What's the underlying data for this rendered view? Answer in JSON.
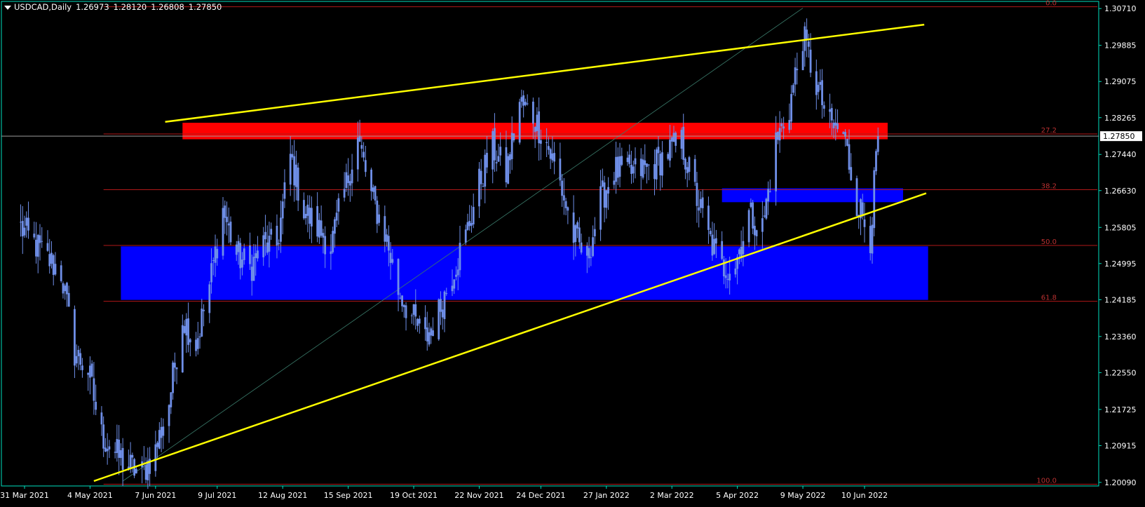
{
  "header": {
    "symbol": "USDCAD,Daily",
    "open": "1.26973",
    "high": "1.28120",
    "low": "1.26808",
    "close": "1.27850"
  },
  "colors": {
    "background": "#000000",
    "axis": "#00e0c0",
    "candle": "#6f8fe8",
    "fib_line": "#b01818",
    "fib_label": "#b83030",
    "trendline": "#ffff00",
    "resistance_zone": "#ff0000",
    "support_zone": "#0000ff",
    "price_line": "#9a9a9a",
    "current_price_bg": "#ffffff",
    "current_price_text": "#000000",
    "diagonal": "#3a7a6a"
  },
  "chart_data": {
    "type": "candlestick",
    "symbol": "USDCAD",
    "timeframe": "Daily",
    "y_ticks": [
      "1.30710",
      "1.29885",
      "1.29075",
      "1.28265",
      "1.27440",
      "1.26630",
      "1.25805",
      "1.24995",
      "1.24185",
      "1.23360",
      "1.22550",
      "1.21725",
      "1.20915",
      "1.20090"
    ],
    "ylim": [
      1.2001,
      1.3087
    ],
    "x_ticks": [
      {
        "label": "31 Mar 2021",
        "date": "2021-03-31"
      },
      {
        "label": "4 May 2021",
        "date": "2021-05-04"
      },
      {
        "label": "7 Jun 2021",
        "date": "2021-06-07"
      },
      {
        "label": "9 Jul 2021",
        "date": "2021-07-09"
      },
      {
        "label": "12 Aug 2021",
        "date": "2021-08-12"
      },
      {
        "label": "15 Sep 2021",
        "date": "2021-09-15"
      },
      {
        "label": "19 Oct 2021",
        "date": "2021-10-19"
      },
      {
        "label": "22 Nov 2021",
        "date": "2021-11-22"
      },
      {
        "label": "24 Dec 2021",
        "date": "2021-12-24"
      },
      {
        "label": "27 Jan 2022",
        "date": "2022-01-27"
      },
      {
        "label": "2 Mar 2022",
        "date": "2022-03-02"
      },
      {
        "label": "5 Apr 2022",
        "date": "2022-04-05"
      },
      {
        "label": "9 May 2022",
        "date": "2022-05-09"
      },
      {
        "label": "10 Jun 2022",
        "date": "2022-06-10"
      }
    ],
    "current_price": "1.27850",
    "fibonacci_levels": [
      {
        "label": "0.0",
        "price": 1.3075
      },
      {
        "label": "27.2",
        "price": 1.279
      },
      {
        "label": "38.2",
        "price": 1.2665
      },
      {
        "label": "50.0",
        "price": 1.254
      },
      {
        "label": "61.8",
        "price": 1.2415
      },
      {
        "label": "100.0",
        "price": 1.2005
      }
    ],
    "zones": [
      {
        "name": "resistance",
        "from_date": "2021-06-21",
        "to_date": "2022-06-22",
        "price_low": 1.2778,
        "price_high": 1.2815
      },
      {
        "name": "support",
        "from_date": "2021-05-20",
        "to_date": "2022-07-13",
        "price_low": 1.2418,
        "price_high": 1.2538
      },
      {
        "name": "intermediate-support",
        "from_date": "2022-03-28",
        "to_date": "2022-06-30",
        "price_low": 1.2637,
        "price_high": 1.2668
      }
    ],
    "trendlines": [
      {
        "name": "upper-channel",
        "start": {
          "date": "2021-06-12",
          "price": 1.2817
        },
        "end": {
          "date": "2022-07-11",
          "price": 1.3035
        }
      },
      {
        "name": "lower-trendline",
        "start": {
          "date": "2021-05-06",
          "price": 1.2012
        },
        "end": {
          "date": "2022-07-12",
          "price": 1.2657
        }
      }
    ],
    "diagonal": {
      "start": {
        "date": "2021-05-21",
        "price": 1.2012
      },
      "end": {
        "date": "2022-05-09",
        "price": 1.3072
      }
    },
    "closes": [
      {
        "date": "2021-03-29",
        "close": 1.258
      },
      {
        "date": "2021-04-05",
        "close": 1.2545
      },
      {
        "date": "2021-04-12",
        "close": 1.251
      },
      {
        "date": "2021-04-19",
        "close": 1.248
      },
      {
        "date": "2021-04-26",
        "close": 1.23
      },
      {
        "date": "2021-05-03",
        "close": 1.226
      },
      {
        "date": "2021-05-10",
        "close": 1.2115
      },
      {
        "date": "2021-05-17",
        "close": 1.2075
      },
      {
        "date": "2021-05-24",
        "close": 1.2045
      },
      {
        "date": "2021-05-31",
        "close": 1.203
      },
      {
        "date": "2021-06-07",
        "close": 1.208
      },
      {
        "date": "2021-06-14",
        "close": 1.219
      },
      {
        "date": "2021-06-21",
        "close": 1.238
      },
      {
        "date": "2021-06-28",
        "close": 1.232
      },
      {
        "date": "2021-07-05",
        "close": 1.245
      },
      {
        "date": "2021-07-12",
        "close": 1.262
      },
      {
        "date": "2021-07-19",
        "close": 1.252
      },
      {
        "date": "2021-07-26",
        "close": 1.249
      },
      {
        "date": "2021-08-02",
        "close": 1.254
      },
      {
        "date": "2021-08-09",
        "close": 1.254
      },
      {
        "date": "2021-08-16",
        "close": 1.274
      },
      {
        "date": "2021-08-23",
        "close": 1.262
      },
      {
        "date": "2021-08-30",
        "close": 1.258
      },
      {
        "date": "2021-09-06",
        "close": 1.254
      },
      {
        "date": "2021-09-13",
        "close": 1.266
      },
      {
        "date": "2021-09-20",
        "close": 1.278
      },
      {
        "date": "2021-09-27",
        "close": 1.265
      },
      {
        "date": "2021-10-04",
        "close": 1.257
      },
      {
        "date": "2021-10-11",
        "close": 1.244
      },
      {
        "date": "2021-10-18",
        "close": 1.238
      },
      {
        "date": "2021-10-25",
        "close": 1.233
      },
      {
        "date": "2021-11-01",
        "close": 1.239
      },
      {
        "date": "2021-11-08",
        "close": 1.248
      },
      {
        "date": "2021-11-15",
        "close": 1.256
      },
      {
        "date": "2021-11-22",
        "close": 1.268
      },
      {
        "date": "2021-11-29",
        "close": 1.276
      },
      {
        "date": "2021-12-06",
        "close": 1.27
      },
      {
        "date": "2021-12-13",
        "close": 1.286
      },
      {
        "date": "2021-12-20",
        "close": 1.283
      },
      {
        "date": "2021-12-27",
        "close": 1.277
      },
      {
        "date": "2022-01-03",
        "close": 1.268
      },
      {
        "date": "2022-01-10",
        "close": 1.256
      },
      {
        "date": "2022-01-17",
        "close": 1.251
      },
      {
        "date": "2022-01-24",
        "close": 1.264
      },
      {
        "date": "2022-01-31",
        "close": 1.271
      },
      {
        "date": "2022-02-07",
        "close": 1.27
      },
      {
        "date": "2022-02-14",
        "close": 1.271
      },
      {
        "date": "2022-02-21",
        "close": 1.272
      },
      {
        "date": "2022-02-28",
        "close": 1.275
      },
      {
        "date": "2022-03-07",
        "close": 1.277
      },
      {
        "date": "2022-03-14",
        "close": 1.266
      },
      {
        "date": "2022-03-21",
        "close": 1.256
      },
      {
        "date": "2022-03-28",
        "close": 1.249
      },
      {
        "date": "2022-04-04",
        "close": 1.25
      },
      {
        "date": "2022-04-11",
        "close": 1.261
      },
      {
        "date": "2022-04-18",
        "close": 1.258
      },
      {
        "date": "2022-04-25",
        "close": 1.277
      },
      {
        "date": "2022-05-02",
        "close": 1.285
      },
      {
        "date": "2022-05-09",
        "close": 1.301
      },
      {
        "date": "2022-05-16",
        "close": 1.29
      },
      {
        "date": "2022-05-23",
        "close": 1.281
      },
      {
        "date": "2022-05-30",
        "close": 1.279
      },
      {
        "date": "2022-06-06",
        "close": 1.264
      },
      {
        "date": "2022-06-13",
        "close": 1.256
      },
      {
        "date": "2022-06-17",
        "close": 1.2785
      }
    ]
  }
}
